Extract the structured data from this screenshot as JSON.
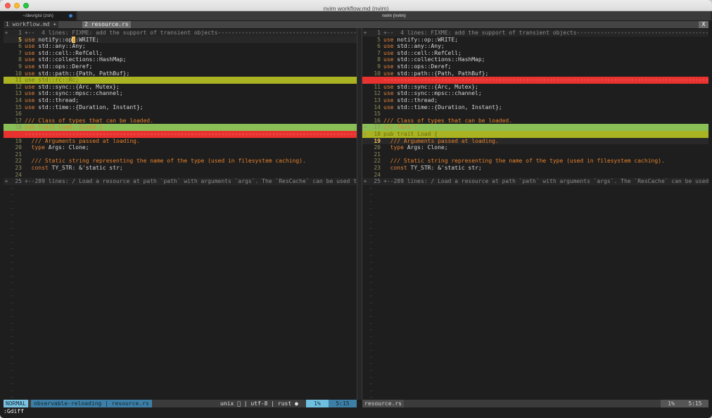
{
  "window": {
    "title": "nvim workflow.md (nvim)"
  },
  "terminal_tabs": [
    {
      "label": "~/dev/glsl (zsh)"
    },
    {
      "label": "nvim (nvim)"
    }
  ],
  "vim_tabs": {
    "tab1": "1 workflow.md +",
    "tab2": "2 resource.rs",
    "close": "X"
  },
  "left_pane": {
    "lines": [
      {
        "type": "fold",
        "sign": "+",
        "num": "1",
        "html": "+--  4 lines: FIXME: add the support of transient objects-------------------------------------------------------"
      },
      {
        "type": "cur",
        "num": "5",
        "numcur": true,
        "html": "<span class=\"kw\">use</span> notify::op<span class=\"cursor\">:</span>:WRITE;"
      },
      {
        "num": "6",
        "html": "<span class=\"kw\">use</span> std::any::Any;"
      },
      {
        "num": "7",
        "html": "<span class=\"kw\">use</span> std::cell::RefCell;"
      },
      {
        "num": "8",
        "html": "<span class=\"kw\">use</span> std::collections::HashMap;"
      },
      {
        "num": "9",
        "html": "<span class=\"kw\">use</span> std::ops::Deref;"
      },
      {
        "num": "10",
        "html": "<span class=\"kw\">use</span> std::path::{Path, PathBuf};"
      },
      {
        "type": "yellow",
        "num": "11",
        "html": "use std::rc::Rc;"
      },
      {
        "num": "12",
        "html": "<span class=\"kw\">use</span> std::sync::{Arc, Mutex};"
      },
      {
        "num": "13",
        "html": "<span class=\"kw\">use</span> std::sync::mpsc::channel;"
      },
      {
        "num": "14",
        "html": "<span class=\"kw\">use</span> std::thread;"
      },
      {
        "num": "15",
        "html": "<span class=\"kw\">use</span> std::time::{Duration, Instant};"
      },
      {
        "num": "16",
        "html": ""
      },
      {
        "num": "17",
        "html": "<span class=\"cm\">/// Class of types that can be loaded.</span>"
      },
      {
        "type": "green",
        "num": "18",
        "html": "<span class=\"cm\">pub trait Load: Sized {</span>"
      },
      {
        "type": "red",
        "num": "",
        "html": "---------------------------------------------------------------------------------------------------------------"
      },
      {
        "num": "19",
        "html": "  <span class=\"cm\">/// Arguments passed at loading.</span>"
      },
      {
        "num": "20",
        "html": "  <span class=\"kw\">type</span> Args: Clone;"
      },
      {
        "num": "21",
        "html": ""
      },
      {
        "num": "22",
        "html": "  <span class=\"cm\">/// Static string representing the name of the type (used in filesystem caching).</span>"
      },
      {
        "num": "23",
        "html": "  <span class=\"kw\">const</span> TY_STR: &'static str;"
      },
      {
        "num": "24",
        "html": ""
      },
      {
        "type": "fold",
        "sign": "+",
        "num": "25",
        "html": "+--289 lines: / Load a resource at path `path` with arguments `args`. The `ResCache` can be used to load"
      }
    ]
  },
  "right_pane": {
    "lines": [
      {
        "type": "fold",
        "sign": "+",
        "num": "1",
        "html": "+--  4 lines: FIXME: add the support of transient objects-------------------------------------------------------"
      },
      {
        "num": "5",
        "html": "<span class=\"kw\">use</span> notify::op::WRITE;"
      },
      {
        "num": "6",
        "html": "<span class=\"kw\">use</span> std::any::Any;"
      },
      {
        "num": "7",
        "html": "<span class=\"kw\">use</span> std::cell::RefCell;"
      },
      {
        "num": "8",
        "html": "<span class=\"kw\">use</span> std::collections::HashMap;"
      },
      {
        "num": "9",
        "html": "<span class=\"kw\">use</span> std::ops::Deref;"
      },
      {
        "num": "10",
        "html": "<span class=\"kw\">use</span> std::path::{Path, PathBuf};"
      },
      {
        "type": "red",
        "sign": "_",
        "num": "",
        "html": "---------------------------------------------------------------------------------------------------------------"
      },
      {
        "num": "11",
        "html": "<span class=\"kw\">use</span> std::sync::{Arc, Mutex};"
      },
      {
        "num": "12",
        "html": "<span class=\"kw\">use</span> std::sync::mpsc::channel;"
      },
      {
        "num": "13",
        "html": "<span class=\"kw\">use</span> std::thread;"
      },
      {
        "num": "14",
        "html": "<span class=\"kw\">use</span> std::time::{Duration, Instant};"
      },
      {
        "num": "15",
        "html": ""
      },
      {
        "num": "16",
        "html": "<span class=\"cm\">/// Class of types that can be loaded.</span>"
      },
      {
        "type": "green",
        "sign": "~",
        "num": "17",
        "html": "<span class=\"cm\">/// Test !</span>"
      },
      {
        "type": "yellow",
        "sign": "+",
        "num": "18",
        "html": "pub trait Load {"
      },
      {
        "type": "cur",
        "num": "19",
        "numcur": true,
        "html": "  <span class=\"cm\">/// Arguments passed at loading.</span>"
      },
      {
        "num": "20",
        "html": "  <span class=\"kw\">type</span> Args: Clone;"
      },
      {
        "num": "21",
        "html": ""
      },
      {
        "num": "22",
        "html": "  <span class=\"cm\">/// Static string representing the name of the type (used in filesystem caching).</span>"
      },
      {
        "num": "23",
        "html": "  <span class=\"kw\">const</span> TY_STR: &'static str;"
      },
      {
        "num": "24",
        "html": ""
      },
      {
        "type": "fold",
        "sign": "+",
        "num": "25",
        "html": "+--289 lines: / Load a resource at path `path` with arguments `args`. The `ResCache` can be used to load"
      }
    ]
  },
  "left_status": {
    "mode": "NORMAL",
    "branch": "observable-reloading | resource.rs",
    "info": "unix   | utf-8 | rust ●",
    "percent": "1%",
    "position": "5:15"
  },
  "right_status": {
    "file": "resource.rs",
    "percent": "1%",
    "position": "5:15"
  },
  "command_line": ":Gdiff"
}
